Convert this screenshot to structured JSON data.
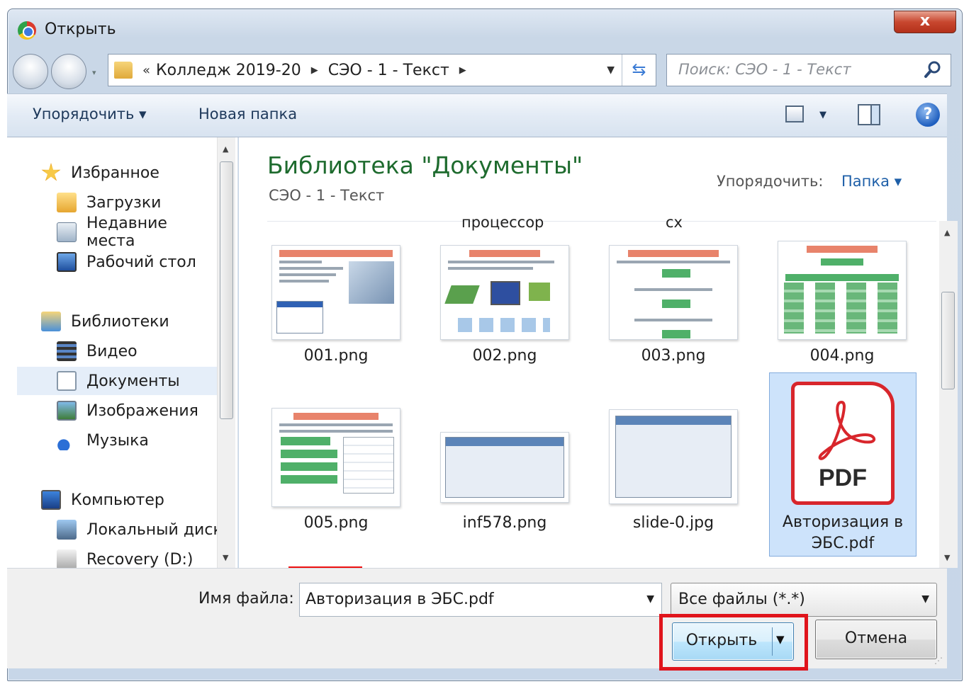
{
  "window": {
    "title": "Открыть",
    "close_glyph": "x"
  },
  "address_bar": {
    "overflow": "«",
    "crumbs": [
      "Колледж 2019-20",
      "СЭО - 1 - Текст"
    ]
  },
  "search": {
    "placeholder": "Поиск: СЭО - 1 - Текст"
  },
  "toolbar": {
    "organize_label": "Упорядочить ▾",
    "new_folder_label": "Новая папка",
    "help_glyph": "?"
  },
  "sidebar": {
    "favorites": {
      "label": "Избранное",
      "items": [
        "Загрузки",
        "Недавние места",
        "Рабочий стол"
      ]
    },
    "libraries": {
      "label": "Библиотеки",
      "items": [
        "Видео",
        "Документы",
        "Изображения",
        "Музыка"
      ],
      "selected": "Документы"
    },
    "computer": {
      "label": "Компьютер",
      "items": [
        "Локальный диск",
        "Recovery (D:)"
      ]
    }
  },
  "content": {
    "library_title": "Библиотека \"Документы\"",
    "library_subtitle": "СЭО - 1 - Текст",
    "arrange_label": "Упорядочить:",
    "arrange_value": "Папка ▾",
    "cut_labels": [
      "процессор",
      "сх"
    ],
    "files": [
      {
        "name": "001.png",
        "kind": "slide-text"
      },
      {
        "name": "002.png",
        "kind": "slide-diagram"
      },
      {
        "name": "003.png",
        "kind": "slide-list"
      },
      {
        "name": "004.png",
        "kind": "slide-tree"
      },
      {
        "name": "005.png",
        "kind": "slide-green"
      },
      {
        "name": "inf578.png",
        "kind": "screenshot"
      },
      {
        "name": "slide-0.jpg",
        "kind": "screenshot"
      },
      {
        "name": "Авторизация в ЭБС.pdf",
        "name_line1": "Авторизация в",
        "name_line2": "ЭБС.pdf",
        "kind": "pdf",
        "selected": true,
        "pdf_badge": "PDF"
      }
    ]
  },
  "bottom": {
    "filename_label": "Имя файла:",
    "filename_value": "Авторизация в ЭБС.pdf",
    "filetype_value": "Все файлы (*.*)",
    "open_label": "Открыть",
    "cancel_label": "Отмена"
  },
  "colors": {
    "highlight": "#e0141b",
    "library_title": "#1e6b2e",
    "pdf_red": "#d8262c"
  }
}
